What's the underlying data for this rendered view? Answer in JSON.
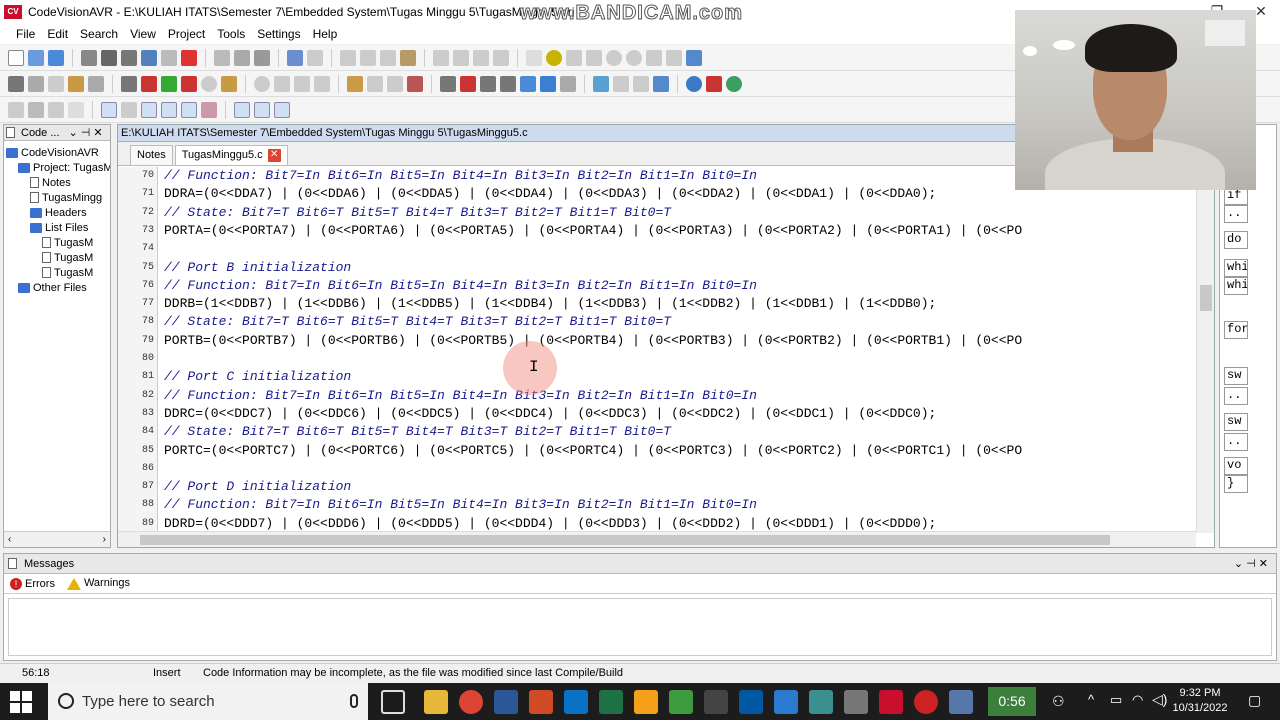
{
  "window": {
    "title": "CodeVisionAVR - E:\\KULIAH ITATS\\Semester 7\\Embedded System\\Tugas Minggu 5\\TugasMinggu5.prj",
    "logo_text": "CV",
    "watermark": "www.BANDICAM.com"
  },
  "menu": [
    "File",
    "Edit",
    "Search",
    "View",
    "Project",
    "Tools",
    "Settings",
    "Help"
  ],
  "project_panel": {
    "header": "Code ...",
    "tree": [
      {
        "label": "CodeVisionAVR",
        "type": "folder",
        "indent": 0
      },
      {
        "label": "Project: TugasM",
        "type": "folder",
        "indent": 1
      },
      {
        "label": "Notes",
        "type": "file",
        "indent": 2
      },
      {
        "label": "TugasMingg",
        "type": "file",
        "indent": 2
      },
      {
        "label": "Headers",
        "type": "folder",
        "indent": 2
      },
      {
        "label": "List Files",
        "type": "folder",
        "indent": 2
      },
      {
        "label": "TugasM",
        "type": "file",
        "indent": 3
      },
      {
        "label": "TugasM",
        "type": "file",
        "indent": 3
      },
      {
        "label": "TugasM",
        "type": "file",
        "indent": 3
      },
      {
        "label": "Other Files",
        "type": "folder",
        "indent": 1
      }
    ]
  },
  "editor": {
    "path": "E:\\KULIAH ITATS\\Semester 7\\Embedded System\\Tugas Minggu 5\\TugasMinggu5.c",
    "tabs": [
      {
        "label": "Notes",
        "active": false
      },
      {
        "label": "TugasMinggu5.c",
        "active": true
      }
    ],
    "lines": [
      {
        "n": "70",
        "text": "// Function: Bit7=In Bit6=In Bit5=In Bit4=In Bit3=In Bit2=In Bit1=In Bit0=In",
        "comment": true
      },
      {
        "n": "71",
        "text": "DDRA=(0<<DDA7) | (0<<DDA6) | (0<<DDA5) | (0<<DDA4) | (0<<DDA3) | (0<<DDA2) | (0<<DDA1) | (0<<DDA0);",
        "comment": false
      },
      {
        "n": "72",
        "text": "// State: Bit7=T Bit6=T Bit5=T Bit4=T Bit3=T Bit2=T Bit1=T Bit0=T",
        "comment": true
      },
      {
        "n": "73",
        "text": "PORTA=(0<<PORTA7) | (0<<PORTA6) | (0<<PORTA5) | (0<<PORTA4) | (0<<PORTA3) | (0<<PORTA2) | (0<<PORTA1) | (0<<PO",
        "comment": false
      },
      {
        "n": "74",
        "text": "",
        "comment": false
      },
      {
        "n": "75",
        "text": "// Port B initialization",
        "comment": true
      },
      {
        "n": "76",
        "text": "// Function: Bit7=In Bit6=In Bit5=In Bit4=In Bit3=In Bit2=In Bit1=In Bit0=In",
        "comment": true
      },
      {
        "n": "77",
        "text": "DDRB=(1<<DDB7) | (1<<DDB6) | (1<<DDB5) | (1<<DDB4) | (1<<DDB3) | (1<<DDB2) | (1<<DDB1) | (1<<DDB0);",
        "comment": false
      },
      {
        "n": "78",
        "text": "// State: Bit7=T Bit6=T Bit5=T Bit4=T Bit3=T Bit2=T Bit1=T Bit0=T",
        "comment": true
      },
      {
        "n": "79",
        "text": "PORTB=(0<<PORTB7) | (0<<PORTB6) | (0<<PORTB5) | (0<<PORTB4) | (0<<PORTB3) | (0<<PORTB2) | (0<<PORTB1) | (0<<PO",
        "comment": false
      },
      {
        "n": "80",
        "text": "",
        "comment": false
      },
      {
        "n": "81",
        "text": "// Port C initialization",
        "comment": true
      },
      {
        "n": "82",
        "text": "// Function: Bit7=In Bit6=In Bit5=In Bit4=In Bit3=In Bit2=In Bit1=In Bit0=In",
        "comment": true
      },
      {
        "n": "83",
        "text": "DDRC=(0<<DDC7) | (0<<DDC6) | (0<<DDC5) | (0<<DDC4) | (0<<DDC3) | (0<<DDC2) | (0<<DDC1) | (0<<DDC0);",
        "comment": false
      },
      {
        "n": "84",
        "text": "// State: Bit7=T Bit6=T Bit5=T Bit4=T Bit3=T Bit2=T Bit1=T Bit0=T",
        "comment": true
      },
      {
        "n": "85",
        "text": "PORTC=(0<<PORTC7) | (0<<PORTC6) | (0<<PORTC5) | (0<<PORTC4) | (0<<PORTC3) | (0<<PORTC2) | (0<<PORTC1) | (0<<PO",
        "comment": false
      },
      {
        "n": "86",
        "text": "",
        "comment": false
      },
      {
        "n": "87",
        "text": "// Port D initialization",
        "comment": true
      },
      {
        "n": "88",
        "text": "// Function: Bit7=In Bit6=In Bit5=In Bit4=In Bit3=In Bit2=In Bit1=In Bit0=In",
        "comment": true
      },
      {
        "n": "89",
        "text": "DDRD=(0<<DDD7) | (0<<DDD6) | (0<<DDD5) | (0<<DDD4) | (0<<DDD3) | (0<<DDD2) | (0<<DDD1) | (0<<DDD0);",
        "comment": false
      }
    ]
  },
  "side_panel": {
    "snippets": [
      "if",
      "..",
      "do",
      "whi",
      "whi",
      "for",
      "sw",
      "..",
      "sw",
      "..",
      "vo",
      "}"
    ]
  },
  "messages": {
    "title": "Messages",
    "tabs": [
      "Errors",
      "Warnings"
    ]
  },
  "statusbar": {
    "position": "56:18",
    "mode": "Insert",
    "message": "Code Information may be incomplete, as the file was modified since last Compile/Build"
  },
  "taskbar": {
    "search_placeholder": "Type here to search",
    "recording_time": "0:56",
    "time": "9:32 PM",
    "date": "10/31/2022"
  },
  "colors": {
    "comment": "#1a1a8c",
    "editor_title_bg": "#cfdcef",
    "taskbar_bg": "#1c1c1c",
    "error": "#cc2222",
    "warning": "#e8b400"
  }
}
